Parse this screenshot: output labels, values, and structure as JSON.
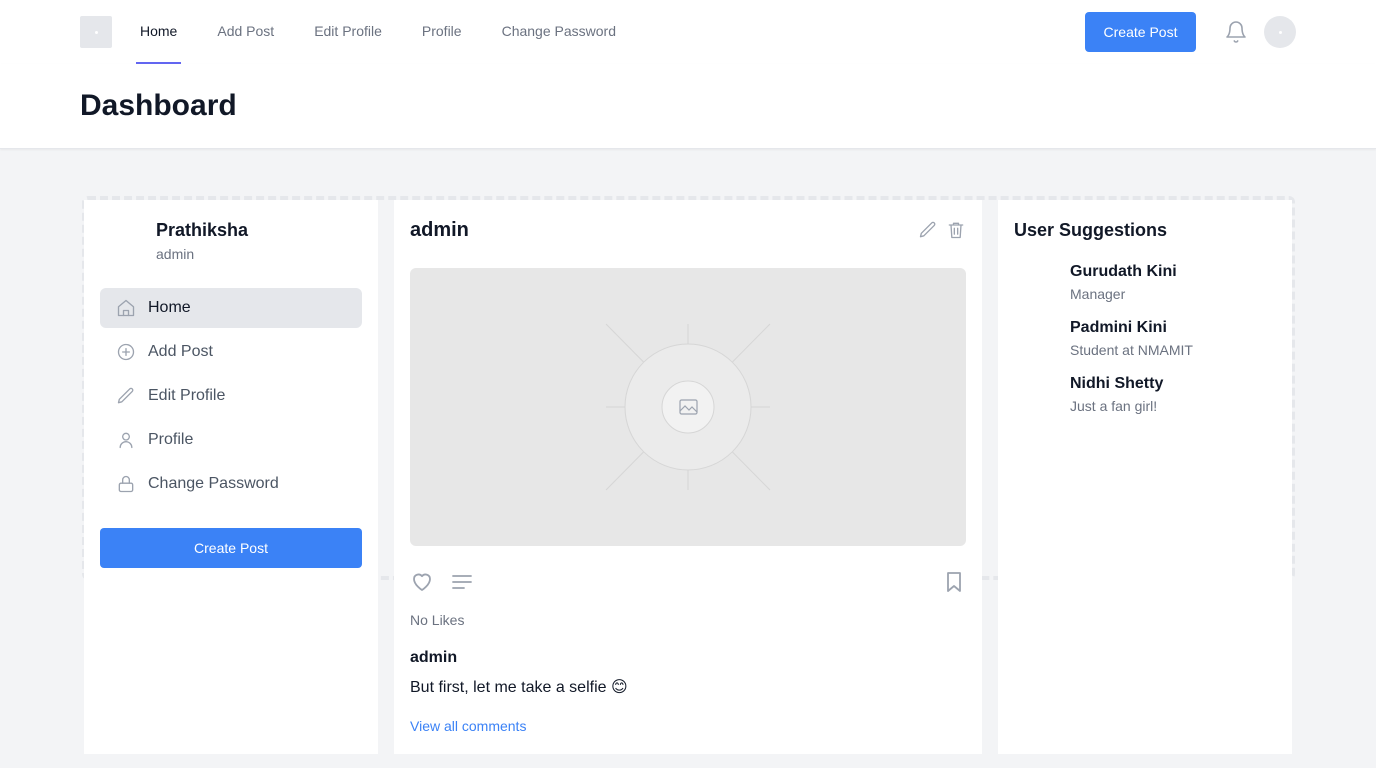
{
  "topnav": {
    "links": [
      {
        "label": "Home",
        "active": true
      },
      {
        "label": "Add Post",
        "active": false
      },
      {
        "label": "Edit Profile",
        "active": false
      },
      {
        "label": "Profile",
        "active": false
      },
      {
        "label": "Change Password",
        "active": false
      }
    ],
    "create_label": "Create Post",
    "notification_icon": "bell-icon"
  },
  "header": {
    "title": "Dashboard"
  },
  "sidebar": {
    "user_name": "Prathiksha",
    "user_role": "admin",
    "items": [
      {
        "label": "Home",
        "icon": "home-icon",
        "active": true
      },
      {
        "label": "Add Post",
        "icon": "plus-circle-icon",
        "active": false
      },
      {
        "label": "Edit Profile",
        "icon": "pencil-icon",
        "active": false
      },
      {
        "label": "Profile",
        "icon": "user-icon",
        "active": false
      },
      {
        "label": "Change Password",
        "icon": "lock-icon",
        "active": false
      }
    ],
    "create_label": "Create Post"
  },
  "post": {
    "author": "admin",
    "likes": "No Likes",
    "caption_author": "admin",
    "caption": "But first, let me take a selfie 😊",
    "view_comments": "View all comments"
  },
  "suggestions": {
    "title": "User Suggestions",
    "users": [
      {
        "name": "Gurudath Kini",
        "subtitle": "Manager"
      },
      {
        "name": "Padmini Kini",
        "subtitle": "Student at NMAMIT"
      },
      {
        "name": "Nidhi Shetty",
        "subtitle": "Just a fan girl!"
      }
    ]
  },
  "colors": {
    "accent": "#3b82f6",
    "active_underline": "#6366f1",
    "page_bg": "#f3f4f6"
  }
}
